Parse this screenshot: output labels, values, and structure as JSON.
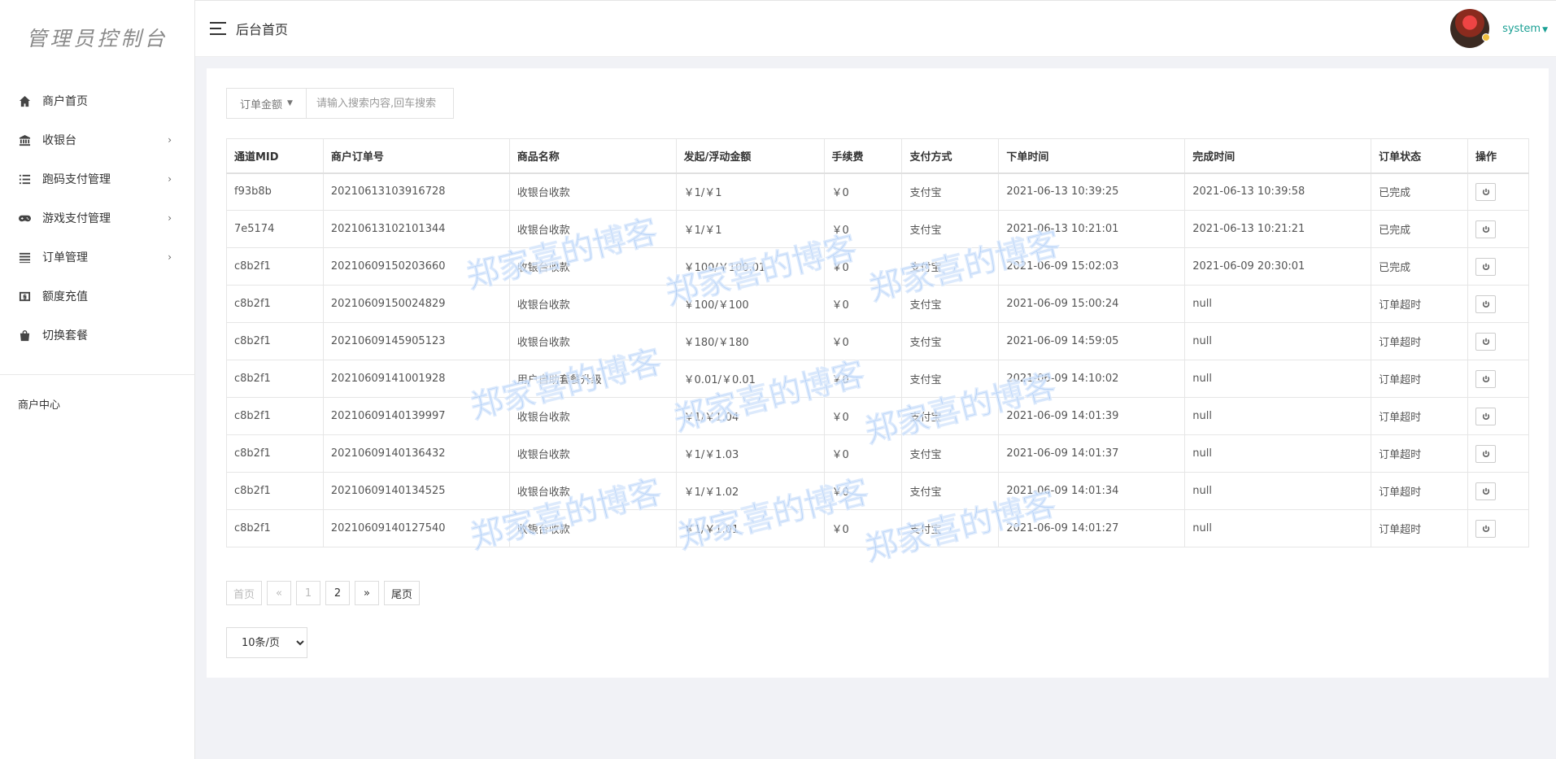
{
  "sidebar": {
    "logo": "管理员控制台",
    "items": [
      {
        "label": "商户首页",
        "arrow": ""
      },
      {
        "label": "收银台",
        "arrow": "›"
      },
      {
        "label": "跑码支付管理",
        "arrow": "›"
      },
      {
        "label": "游戏支付管理",
        "arrow": "›"
      },
      {
        "label": "订单管理",
        "arrow": "›"
      },
      {
        "label": "额度充值",
        "arrow": ""
      },
      {
        "label": "切换套餐",
        "arrow": ""
      }
    ],
    "section_title": "商户中心"
  },
  "topbar": {
    "breadcrumb": "后台首页",
    "username": "system"
  },
  "search": {
    "field": "订单金额",
    "placeholder": "请输入搜索内容,回车搜索"
  },
  "table": {
    "headers": [
      "通道MID",
      "商户订单号",
      "商品名称",
      "发起/浮动金额",
      "手续费",
      "支付方式",
      "下单时间",
      "完成时间",
      "订单状态",
      "操作"
    ],
    "rows": [
      [
        "f93b8b",
        "20210613103916728",
        "收银台收款",
        "￥1/￥1",
        "￥0",
        "支付宝",
        "2021-06-13 10:39:25",
        "2021-06-13 10:39:58",
        "已完成"
      ],
      [
        "7e5174",
        "20210613102101344",
        "收银台收款",
        "￥1/￥1",
        "￥0",
        "支付宝",
        "2021-06-13 10:21:01",
        "2021-06-13 10:21:21",
        "已完成"
      ],
      [
        "c8b2f1",
        "20210609150203660",
        "收银台收款",
        "￥100/￥100.01",
        "￥0",
        "支付宝",
        "2021-06-09 15:02:03",
        "2021-06-09 20:30:01",
        "已完成"
      ],
      [
        "c8b2f1",
        "20210609150024829",
        "收银台收款",
        "￥100/￥100",
        "￥0",
        "支付宝",
        "2021-06-09 15:00:24",
        "null",
        "订单超时"
      ],
      [
        "c8b2f1",
        "20210609145905123",
        "收银台收款",
        "￥180/￥180",
        "￥0",
        "支付宝",
        "2021-06-09 14:59:05",
        "null",
        "订单超时"
      ],
      [
        "c8b2f1",
        "20210609141001928",
        "用户自助套餐升级",
        "￥0.01/￥0.01",
        "￥0",
        "支付宝",
        "2021-06-09 14:10:02",
        "null",
        "订单超时"
      ],
      [
        "c8b2f1",
        "20210609140139997",
        "收银台收款",
        "￥1/￥1.04",
        "￥0",
        "支付宝",
        "2021-06-09 14:01:39",
        "null",
        "订单超时"
      ],
      [
        "c8b2f1",
        "20210609140136432",
        "收银台收款",
        "￥1/￥1.03",
        "￥0",
        "支付宝",
        "2021-06-09 14:01:37",
        "null",
        "订单超时"
      ],
      [
        "c8b2f1",
        "20210609140134525",
        "收银台收款",
        "￥1/￥1.02",
        "￥0",
        "支付宝",
        "2021-06-09 14:01:34",
        "null",
        "订单超时"
      ],
      [
        "c8b2f1",
        "20210609140127540",
        "收银台收款",
        "￥1/￥1.01",
        "￥0",
        "支付宝",
        "2021-06-09 14:01:27",
        "null",
        "订单超时"
      ]
    ]
  },
  "pager": {
    "first": "首页",
    "prev": "«",
    "pages": [
      "1",
      "2"
    ],
    "next": "»",
    "last": "尾页"
  },
  "page_size": {
    "selected": "10条/页"
  },
  "watermark": "郑家喜的博客",
  "colors": {
    "accent": "#1aa094",
    "status_done": "#28a745",
    "status_timeout": "#e84545",
    "null_value": "#f0883e"
  }
}
